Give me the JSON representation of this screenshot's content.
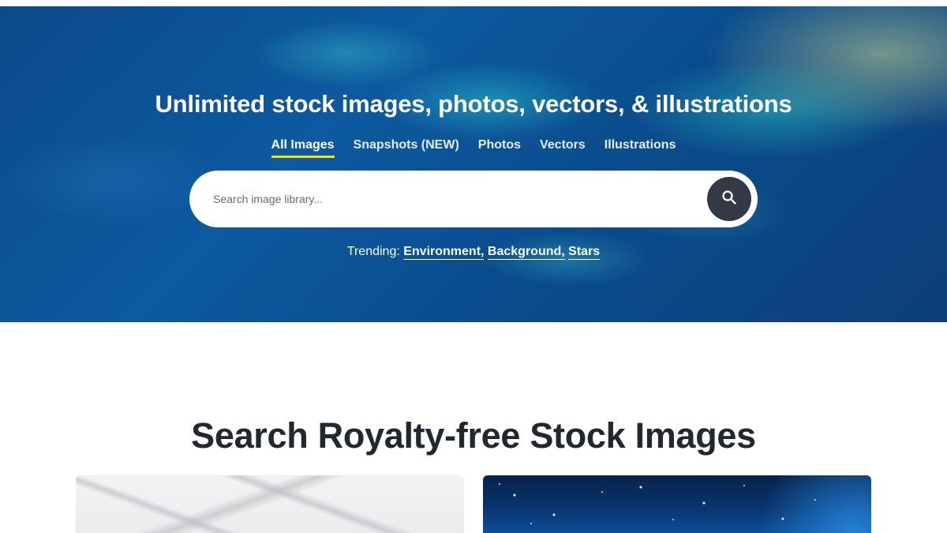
{
  "hero": {
    "title": "Unlimited stock images, photos, vectors, & illustrations",
    "tabs": [
      {
        "label": "All Images",
        "active": true
      },
      {
        "label": "Snapshots (NEW)",
        "active": false
      },
      {
        "label": "Photos",
        "active": false
      },
      {
        "label": "Vectors",
        "active": false
      },
      {
        "label": "Illustrations",
        "active": false
      }
    ],
    "search": {
      "placeholder": "Search image library...",
      "value": "",
      "button_icon": "search-icon"
    },
    "trending": {
      "label": "Trending:",
      "links": [
        "Environment,",
        "Background,",
        "Stars"
      ]
    }
  },
  "section": {
    "title": "Search Royalty-free Stock Images"
  },
  "colors": {
    "accent_underline": "#f4e400",
    "search_button": "#343a45",
    "heading": "#222831"
  }
}
